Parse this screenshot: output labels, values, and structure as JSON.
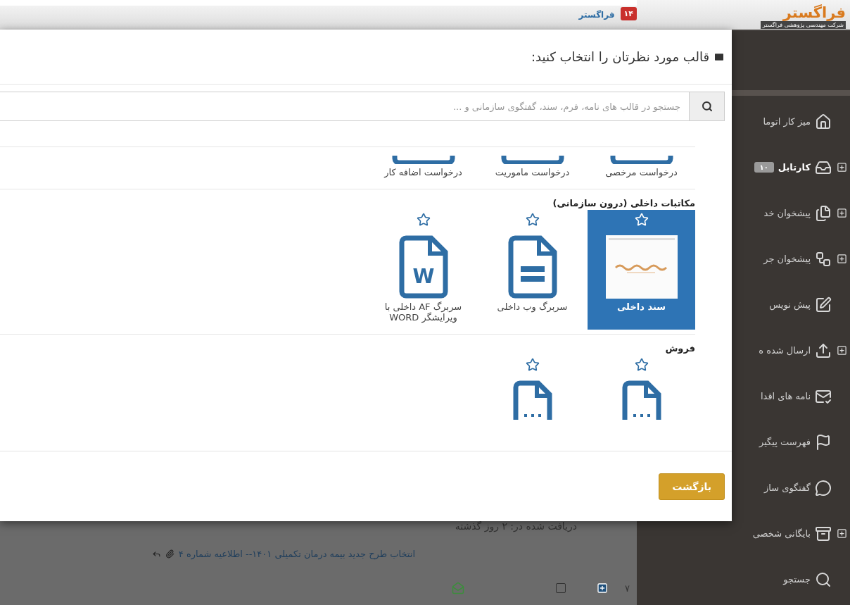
{
  "header": {
    "brand": "فراگستر",
    "badge": "۱۴"
  },
  "logo": {
    "name": "فراگستر",
    "tagline": "شرکت مهندسی پژوهشی فراگستر"
  },
  "sidebar": {
    "items": [
      {
        "label": "میز کار اتوما",
        "expandable": false,
        "selected": false
      },
      {
        "label": "کارتابل",
        "expandable": true,
        "selected": true,
        "badge": "۱۰"
      },
      {
        "label": "پیشخوان خد",
        "expandable": true,
        "selected": false
      },
      {
        "label": "پیشخوان جر",
        "expandable": true,
        "selected": false
      },
      {
        "label": "پیش نویس",
        "expandable": false,
        "selected": false
      },
      {
        "label": "ارسال شده ه",
        "expandable": true,
        "selected": false
      },
      {
        "label": "نامه های اقدا",
        "expandable": false,
        "selected": false
      },
      {
        "label": "فهرست پیگیر",
        "expandable": false,
        "selected": false
      },
      {
        "label": "گفتگوی ساز",
        "expandable": false,
        "selected": false
      },
      {
        "label": "بایگانی شخصی",
        "expandable": true,
        "selected": false
      },
      {
        "label": "جستجو",
        "expandable": false,
        "selected": false
      }
    ]
  },
  "modal": {
    "title": "قالب مورد نظرتان را انتخاب کنید:",
    "search": {
      "placeholder": "جستجو در قالب های نامه، فرم، سند، گفتگوی سازمانی و ..."
    },
    "sections": [
      {
        "items": [
          {
            "kind": "base",
            "label": "درخواست مرخصی",
            "selected": false
          },
          {
            "kind": "base",
            "label": "درخواست ماموریت",
            "selected": false
          },
          {
            "kind": "base",
            "label": "درخواست اضافه کار",
            "selected": false
          }
        ]
      },
      {
        "title": "مکاتبات داخلی (درون سازمانی)",
        "items": [
          {
            "kind": "thumbnail",
            "label": "سند داخلی",
            "selected": true,
            "starred": false
          },
          {
            "kind": "lines",
            "label": "سربرگ وب داخلی",
            "selected": false,
            "starred": false
          },
          {
            "kind": "word",
            "icon_text": "W",
            "label": "سربرگ AF داخلی با ویرایشگر WORD",
            "selected": false,
            "starred": false
          }
        ]
      },
      {
        "title": "فروش",
        "items": [
          {
            "kind": "dots",
            "selected": false,
            "starred": false
          },
          {
            "kind": "dots",
            "selected": false,
            "starred": false
          }
        ]
      }
    ],
    "back_button": "بازگشت"
  },
  "background": {
    "received": "دریافت شده در: ۲ روز گذشته",
    "message": "انتخاب طرح جدید بیمه درمان تکمیلی ۱۴۰۱-- اطلاعیه شماره ۴",
    "row_number": "۷",
    "checked": false
  }
}
